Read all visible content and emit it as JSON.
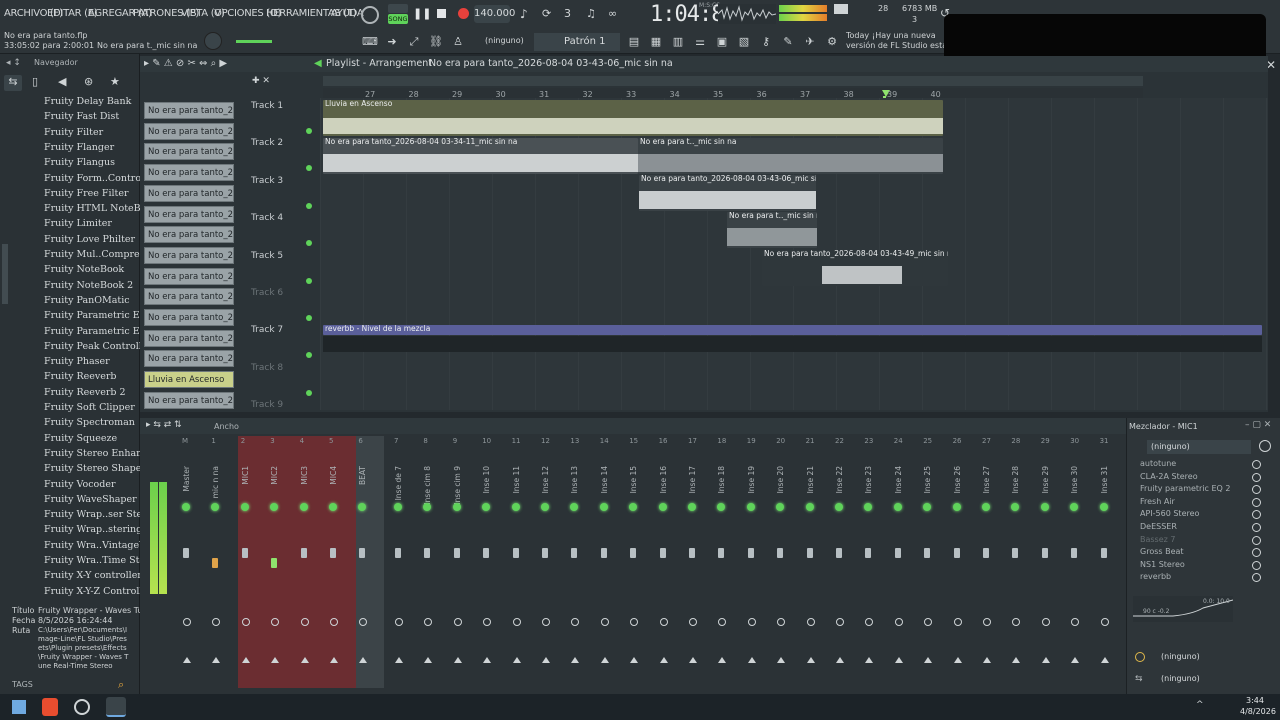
{
  "menu": [
    "ARCHIVO (F)",
    "EDITAR (E)",
    "AGREGAR (A)",
    "PATRONES (P)",
    "VISTA (V)",
    "OPCIONES (O)",
    "HERRAMIENTAS (T)",
    "AYUDA"
  ],
  "project": {
    "file": "No era para tanto.flp",
    "time_info": "33:05:02 para 2:00:01",
    "hint": "No era para t._mic sin na"
  },
  "transport": {
    "song_mode": "SONG",
    "tempo": "140.000",
    "time": "1:04:85",
    "time_label": "M:S:CS",
    "cpu": "28",
    "memory": "6783 MB",
    "voices": "3"
  },
  "pattern": {
    "selected": "Patrón 1",
    "none": "(ninguno)"
  },
  "news": {
    "date": "Today",
    "text1": "¡Hay una nueva",
    "text2": "versión de FL Studio está d."
  },
  "browser": {
    "title": "Navegador",
    "plugins": [
      "Fruity Delay Bank",
      "Fruity Fast Dist",
      "Fruity Filter",
      "Fruity Flanger",
      "Fruity Flangus",
      "Fruity Form..Controller",
      "Fruity Free Filter",
      "Fruity HTML NoteBook",
      "Fruity Limiter",
      "Fruity Love Philter",
      "Fruity Mul..Compressor",
      "Fruity NoteBook",
      "Fruity NoteBook 2",
      "Fruity PanOMatic",
      "Fruity Parametric EQ",
      "Fruity Parametric EQ 2",
      "Fruity Peak Controller",
      "Fruity Phaser",
      "Fruity Reeverb",
      "Fruity Reeverb 2",
      "Fruity Soft Clipper",
      "Fruity Spectroman",
      "Fruity Squeeze",
      "Fruity Stereo Enhancer",
      "Fruity Stereo Shaper",
      "Fruity Vocoder",
      "Fruity WaveShaper",
      "Fruity Wrap..ser Stereo",
      "Fruity Wrap..stering Pro",
      "Fruity Wra..VintageVerb",
      "Fruity Wra..Time Stereo",
      "Fruity X-Y controller",
      "Fruity X-Y-Z Controller"
    ],
    "info": {
      "title_label": "Título",
      "title": "Fruity Wrapper - Waves Tun",
      "date_label": "Fecha",
      "date": "8/5/2026 16:24:44",
      "path_label": "Ruta",
      "path": "C:\\Users\\Fer\\Documents\\Image-Line\\FL Studio\\Presets\\Plugin presets\\Effects\\Fruity Wrapper - Waves Tune Real-Time Stereo"
    },
    "tags": "TAGS"
  },
  "playlist": {
    "title": "Playlist - Arrangement",
    "pattern": "No era para tanto_2026-08-04 03-43-06_mic sin na",
    "bars": [
      "27",
      "28",
      "29",
      "30",
      "31",
      "32",
      "33",
      "34",
      "35",
      "36",
      "37",
      "38",
      "39",
      "40"
    ],
    "tracks": [
      "Track 1",
      "Track 2",
      "Track 3",
      "Track 4",
      "Track 5",
      "Track 6",
      "Track 7",
      "Track 8",
      "Track 9"
    ],
    "clips": {
      "c1": "Lluvia en Ascenso",
      "c2": "No era para tanto_2026-08-04 03-34-11_mic sin na",
      "c2b": "No era para t.._mic sin na",
      "c3": "No era para tanto_2026-08-04 03-43-06_mic sin na",
      "c4": "No era para t.._mic sin na",
      "c5": "No era para tanto_2026-08-04 03-43-49_mic sin na",
      "c7": "reverbb - Nivel de la mezcla"
    }
  },
  "channels": [
    "No era para tanto_2026-",
    "No era para tanto_2026-",
    "No era para tanto_2026-",
    "No era para tanto_2026-",
    "No era para tanto_2026-",
    "No era para tanto_2026-",
    "No era para tanto_2026-",
    "No era para tanto_2026-",
    "No era para tanto_2026-",
    "No era para tanto_2026-",
    "No era para tanto_2026-",
    "No era para tanto_2026-",
    "No era para tanto_2026-",
    "Lluvia en Ascenso",
    "No era para tanto_2026-"
  ],
  "mixer": {
    "width_label": "Ancho",
    "panel_title": "Mezclador - MIC1",
    "selected": "(ninguno)",
    "strips": [
      "Master",
      "mic n na",
      "MIC1",
      "MIC2",
      "MIC3",
      "MIC4",
      "BEAT",
      "Inse de 7",
      "Inse cim 8",
      "Inse cim 9",
      "Inse 10",
      "Inse 11",
      "Inse 12",
      "Inse 13",
      "Inse 14",
      "Inse 15",
      "Inse 16",
      "Inse 17",
      "Inse 18",
      "Inse 19",
      "Inse 20",
      "Inse 21",
      "Inse 22",
      "Inse 23",
      "Inse 24",
      "Inse 25",
      "Inse 26",
      "Inse 27",
      "Inse 28",
      "Inse 29",
      "Inse 30",
      "Inse 31"
    ],
    "numbers": [
      "M",
      "1",
      "2",
      "3",
      "4",
      "5",
      "6",
      "7",
      "8",
      "9",
      "10",
      "11",
      "12",
      "13",
      "14",
      "15",
      "16",
      "17",
      "18",
      "19",
      "20",
      "21",
      "22",
      "23",
      "24",
      "25",
      "26",
      "27",
      "28",
      "29",
      "30",
      "31"
    ],
    "slots": [
      "autotune",
      "CLA-2A Stereo",
      "Fruity parametric EQ 2",
      "Fresh Air",
      "API-560 Stereo",
      "DeESSER",
      "Bassez 7",
      "Gross Beat",
      "NS1 Stereo",
      "reverbb"
    ],
    "eq_label": "0.0: 10.0",
    "eq_val": "90 c -0.2",
    "send1": "(ninguno)",
    "send2": "(ninguno)"
  },
  "taskbar": {
    "time": "3:44",
    "date": "4/8/2026"
  }
}
